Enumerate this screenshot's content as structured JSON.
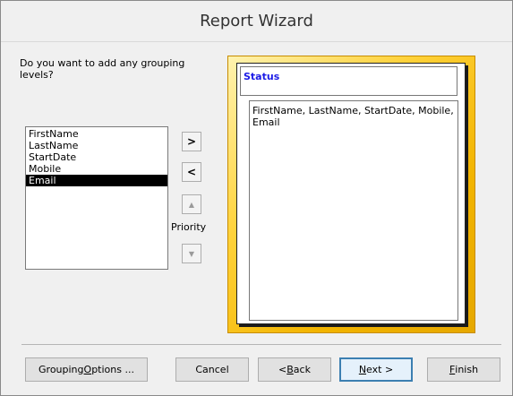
{
  "window": {
    "title": "Report Wizard"
  },
  "prompt": {
    "text": "Do you want to add any grouping levels?"
  },
  "fields": {
    "items": [
      {
        "label": "FirstName",
        "selected": false
      },
      {
        "label": "LastName",
        "selected": false
      },
      {
        "label": "StartDate",
        "selected": false
      },
      {
        "label": "Mobile",
        "selected": false
      },
      {
        "label": "Email",
        "selected": true
      }
    ]
  },
  "move_buttons": {
    "add_label": ">",
    "remove_label": "<",
    "priority_label": "Priority"
  },
  "preview": {
    "group_header": "Status",
    "detail_fields": "FirstName, LastName, StartDate, Mobile, Email"
  },
  "footer": {
    "grouping_options_pre": "Grouping ",
    "grouping_options_key": "O",
    "grouping_options_post": "ptions ...",
    "cancel_label": "Cancel",
    "back_pre": "< ",
    "back_key": "B",
    "back_post": "ack",
    "next_key": "N",
    "next_post": "ext >",
    "finish_key": "F",
    "finish_post": "inish"
  }
}
